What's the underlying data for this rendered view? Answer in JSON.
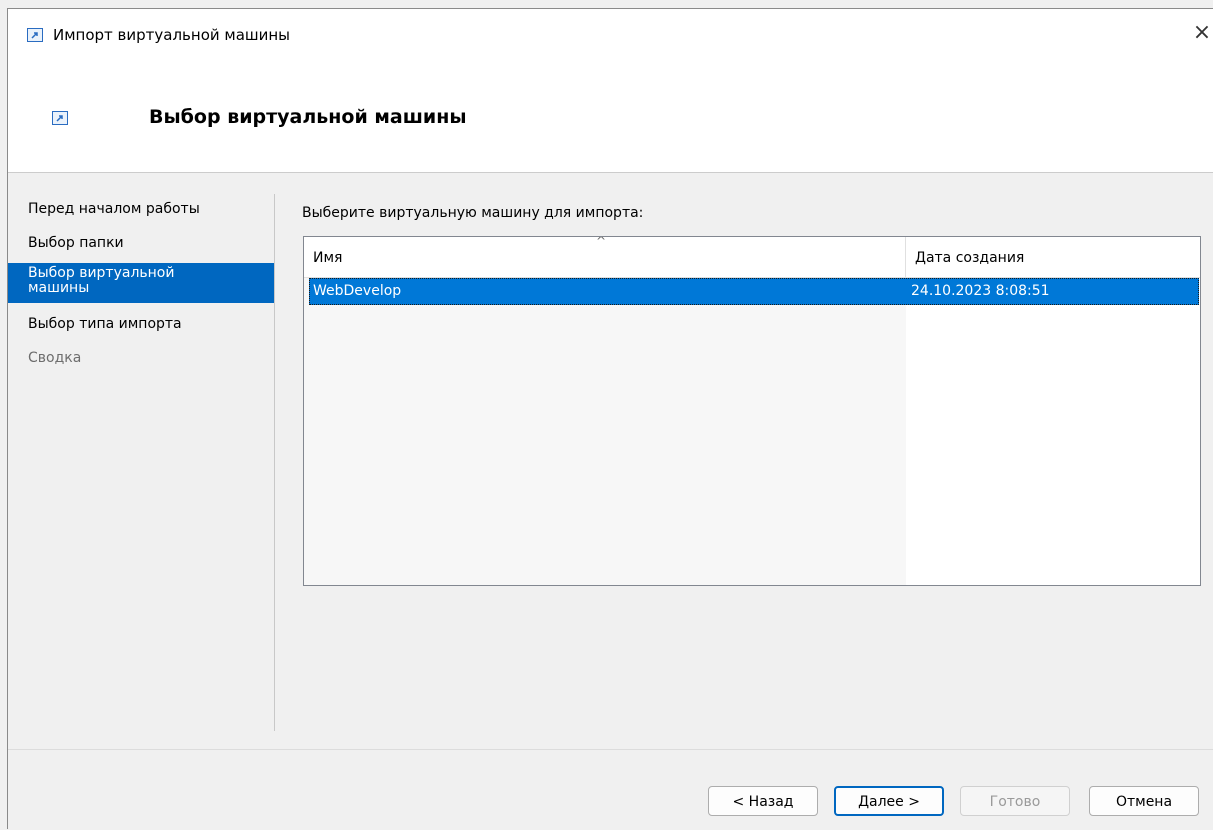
{
  "window": {
    "title": "Импорт виртуальной машины",
    "close_glyph": "×"
  },
  "header": {
    "title": "Выбор виртуальной машины",
    "icon": "import-vm-icon"
  },
  "nav": {
    "items": [
      {
        "label": "Перед началом работы",
        "state": "normal"
      },
      {
        "label": "Выбор папки",
        "state": "normal"
      },
      {
        "label": "Выбор виртуальной машины",
        "state": "selected"
      },
      {
        "label": "Выбор типа импорта",
        "state": "normal"
      },
      {
        "label": "Сводка",
        "state": "disabled"
      }
    ],
    "selected_line1": "Выбор виртуальной",
    "selected_line2": "машины"
  },
  "main": {
    "prompt": "Выберите виртуальную машину для импорта:",
    "table": {
      "columns": [
        "Имя",
        "Дата создания"
      ],
      "sort_indicator": "^",
      "rows": [
        {
          "name": "WebDevelop",
          "date": "24.10.2023 8:08:51",
          "selected": true
        }
      ]
    }
  },
  "footer": {
    "back": "< Назад",
    "next": "Далее >",
    "finish": "Готово",
    "cancel": "Отмена"
  },
  "colors": {
    "accent": "#0067c0",
    "selection": "#0078d7"
  }
}
